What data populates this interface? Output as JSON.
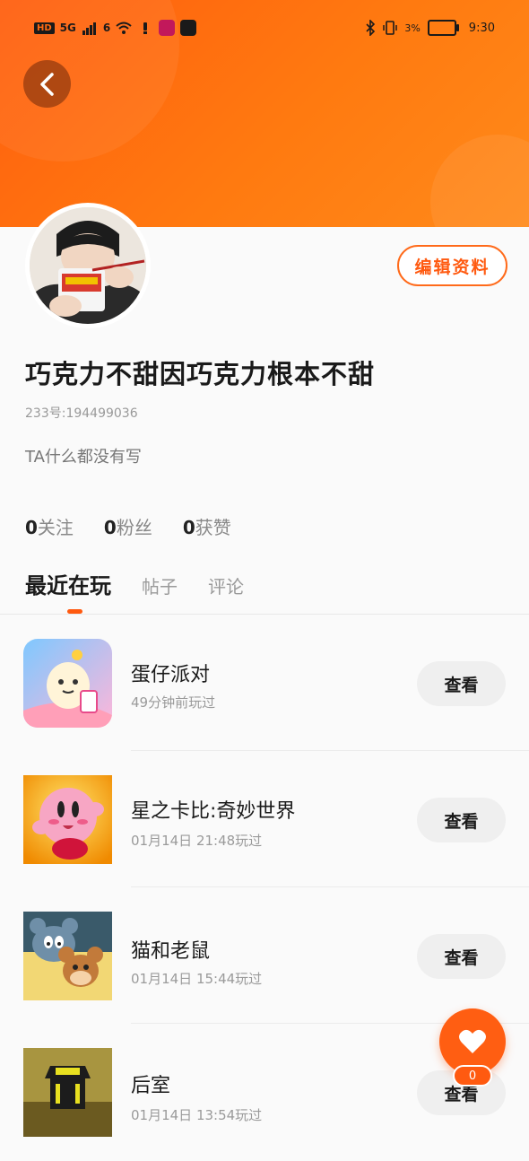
{
  "status_bar": {
    "hd": "HD",
    "net1": "5G",
    "net2": "6",
    "battery_pct": "3%",
    "time": "9:30"
  },
  "profile": {
    "nickname": "巧克力不甜因巧克力根本不甜",
    "uid": "233号:194499036",
    "bio": "TA什么都没有写",
    "edit_label": "编辑资料"
  },
  "stats": [
    {
      "count": "0",
      "label": "关注"
    },
    {
      "count": "0",
      "label": "粉丝"
    },
    {
      "count": "0",
      "label": "获赞"
    }
  ],
  "tabs": [
    {
      "label": "最近在玩"
    },
    {
      "label": "帖子"
    },
    {
      "label": "评论"
    }
  ],
  "games": [
    {
      "title": "蛋仔派对",
      "played": "49分钟前玩过",
      "button": "查看",
      "icon": "eggy-party-icon"
    },
    {
      "title": "星之卡比:奇妙世界",
      "played": "01月14日 21:48玩过",
      "button": "查看",
      "icon": "kirby-icon"
    },
    {
      "title": "猫和老鼠",
      "played": "01月14日 15:44玩过",
      "button": "查看",
      "icon": "tom-and-jerry-icon"
    },
    {
      "title": "后室",
      "played": "01月14日 13:54玩过",
      "button": "查看",
      "icon": "backrooms-icon"
    }
  ],
  "like_fab": {
    "count": "0",
    "icon": "heart-icon"
  },
  "colors": {
    "accent": "#ff5a10",
    "header_start": "#ff5e0e",
    "header_end": "#ff8a1a"
  }
}
